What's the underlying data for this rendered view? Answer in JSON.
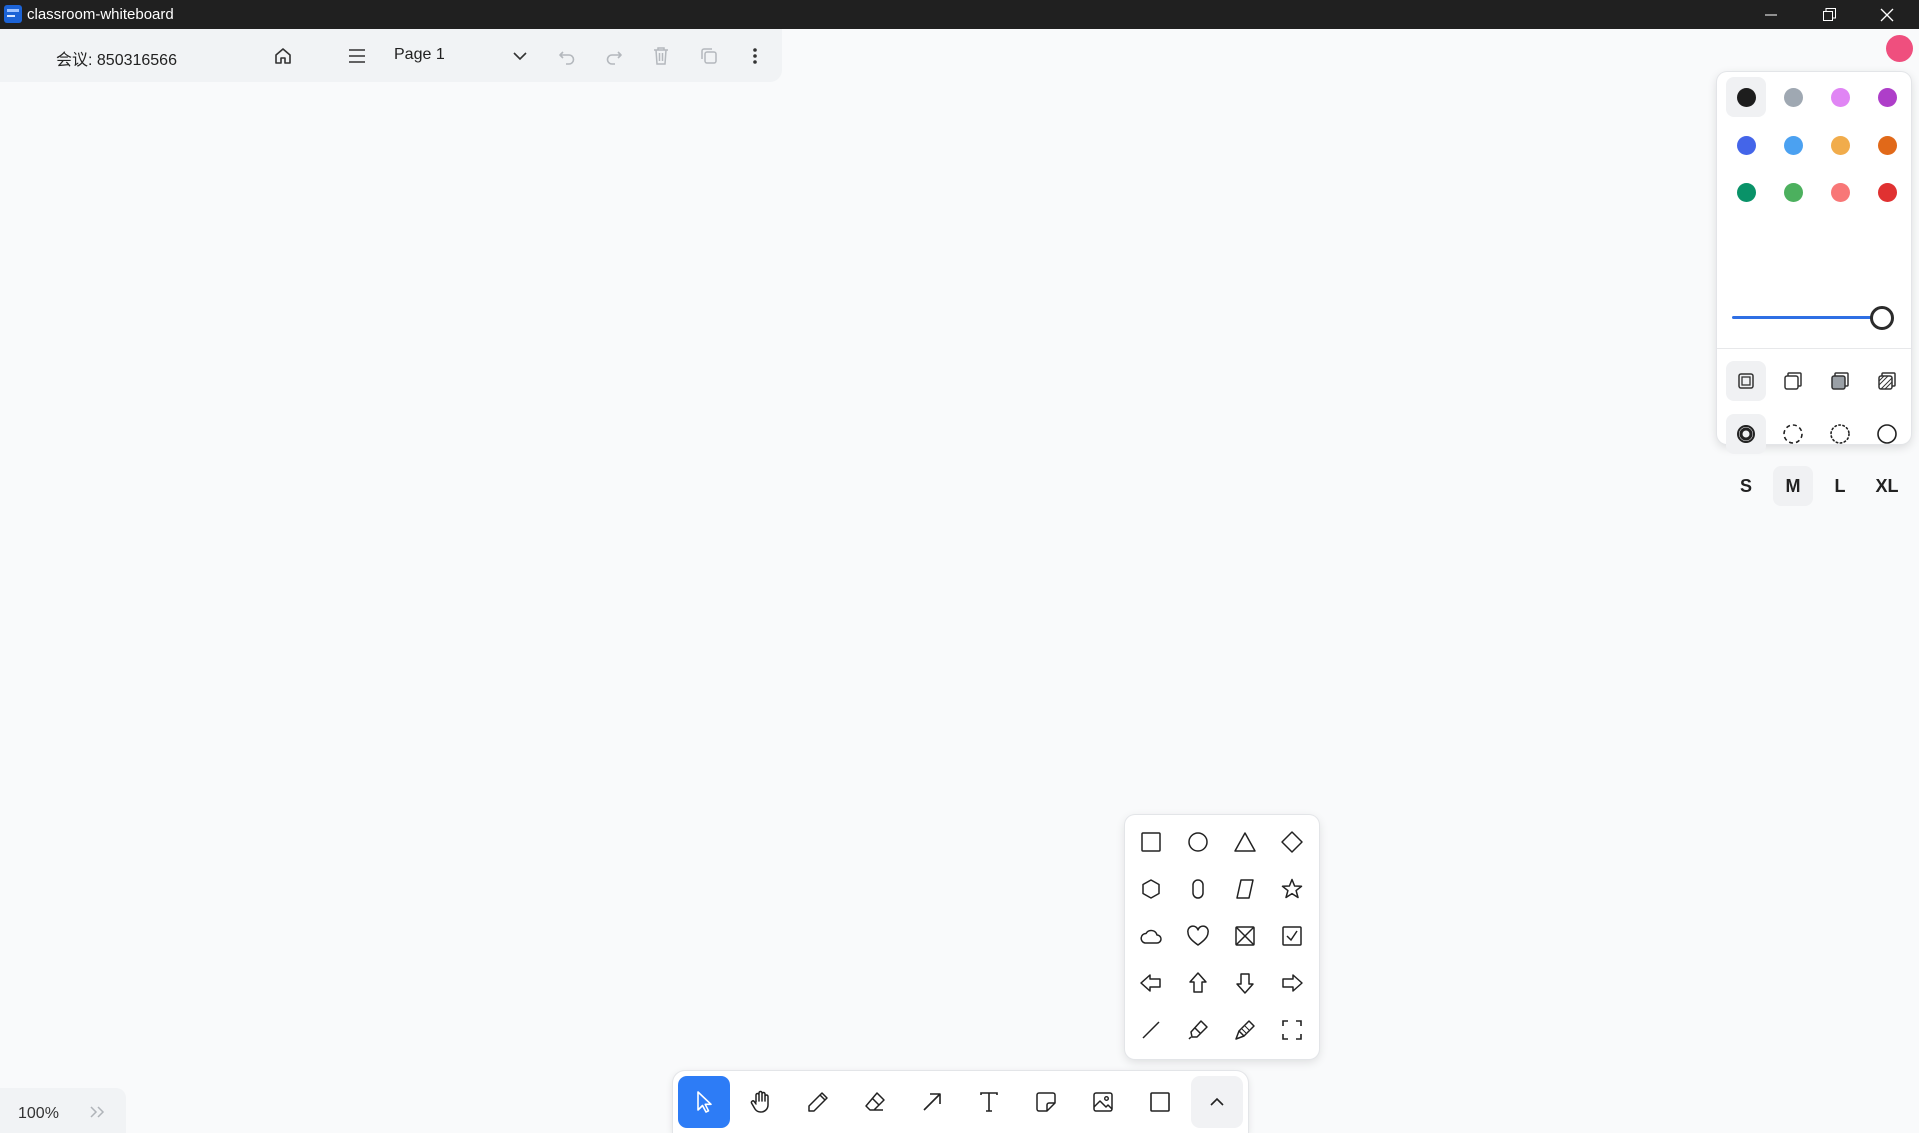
{
  "window": {
    "title": "classroom-whiteboard"
  },
  "topbar": {
    "meeting_label": "会议: 850316566",
    "page_name": "Page 1"
  },
  "zoom": {
    "value": "100%"
  },
  "toolbar": {
    "tools": [
      "select",
      "hand",
      "draw",
      "eraser",
      "arrow",
      "text",
      "note",
      "asset",
      "rectangle",
      "more"
    ],
    "active_tool": "select"
  },
  "shapes_panel": {
    "shapes": [
      "rectangle",
      "ellipse",
      "triangle",
      "diamond",
      "hexagon",
      "oval",
      "trapezoid",
      "star",
      "cloud",
      "heart",
      "x-box",
      "check-box",
      "arrow-left",
      "arrow-up",
      "arrow-down",
      "arrow-right",
      "line",
      "highlight",
      "laser",
      "frame"
    ]
  },
  "style_panel": {
    "colors": [
      "#1d1d1d",
      "#9fa8b2",
      "#e085f4",
      "#ae3ec9",
      "#4465e9",
      "#4ba1f1",
      "#f1ac4b",
      "#e16919",
      "#099268",
      "#4cb05e",
      "#f87777",
      "#e03131"
    ],
    "selected_color": "#1d1d1d",
    "opacity": 1.0,
    "fill_options": [
      "none",
      "semi",
      "solid",
      "pattern"
    ],
    "dash_options": [
      "draw",
      "dashed",
      "dotted",
      "solid"
    ],
    "sizes": [
      "S",
      "M",
      "L",
      "XL"
    ],
    "selected_size": "M"
  },
  "user": {
    "avatar_color": "#ef4f7e"
  }
}
